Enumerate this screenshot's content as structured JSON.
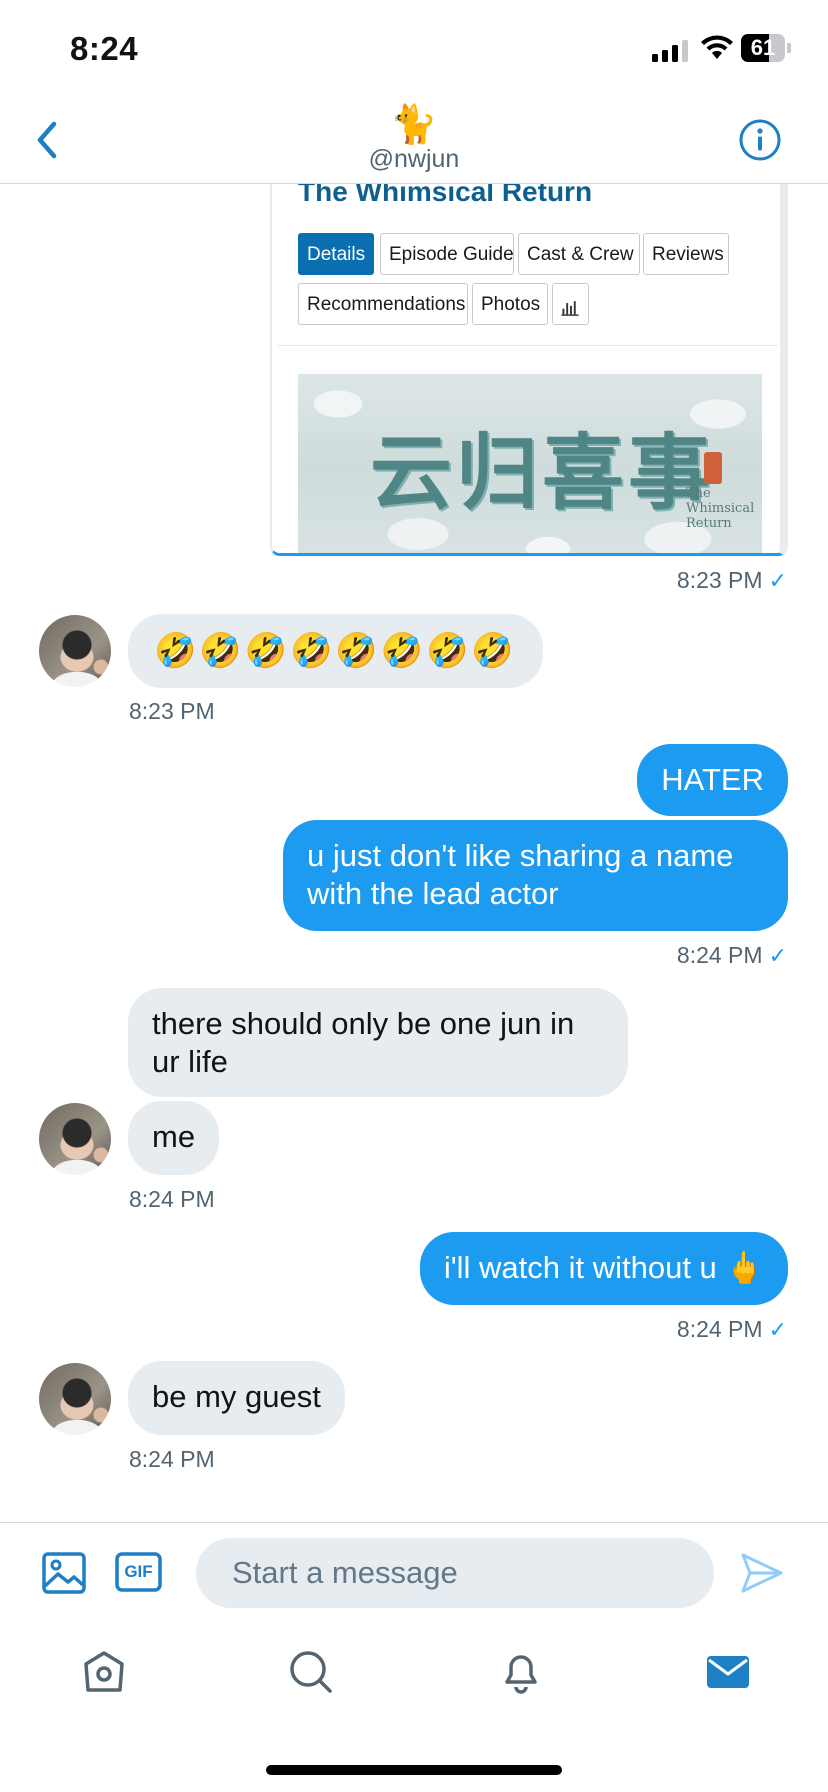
{
  "status_bar": {
    "time": "8:24",
    "battery": "61"
  },
  "header": {
    "avatar_emoji": "🐈",
    "handle": "@nwjun"
  },
  "shared_card": {
    "title": "The Whimsical Return",
    "tabs": [
      "Details",
      "Episode Guide",
      "Cast & Crew",
      "Reviews",
      "Recommendations",
      "Photos"
    ],
    "active_tab": "Details",
    "poster_title": "云归喜事",
    "poster_subtitle": "The Whimsical Return"
  },
  "messages": [
    {
      "side": "out",
      "kind": "card",
      "time": "8:23 PM",
      "check": "✓"
    },
    {
      "side": "in",
      "text": "🤣🤣🤣🤣🤣🤣🤣🤣",
      "time": "8:23 PM"
    },
    {
      "side": "out",
      "text": "HATER"
    },
    {
      "side": "out",
      "text": "u just don't like sharing a name with the lead actor",
      "time": "8:24 PM",
      "check": "✓"
    },
    {
      "side": "in",
      "text": "there should only be one jun in ur life"
    },
    {
      "side": "in",
      "text": "me",
      "time": "8:24 PM"
    },
    {
      "side": "out",
      "text": "i'll watch it without u 🖕",
      "time": "8:24 PM",
      "check": "✓"
    },
    {
      "side": "in",
      "text": "be my guest",
      "time": "8:24 PM"
    }
  ],
  "composer": {
    "placeholder": "Start a message",
    "gif_label": "GIF"
  },
  "icons": {
    "back": "back-chevron-icon",
    "info": "info-icon",
    "image": "image-icon",
    "gif": "gif-icon",
    "send": "send-icon",
    "tabs": [
      "home-icon",
      "search-icon",
      "notifications-icon",
      "messages-icon"
    ]
  },
  "colors": {
    "accent": "#1d9bf0",
    "incoming_bubble": "#e7ecf1",
    "muted_text": "#536471",
    "card_tab_active": "#0a6fb1"
  }
}
